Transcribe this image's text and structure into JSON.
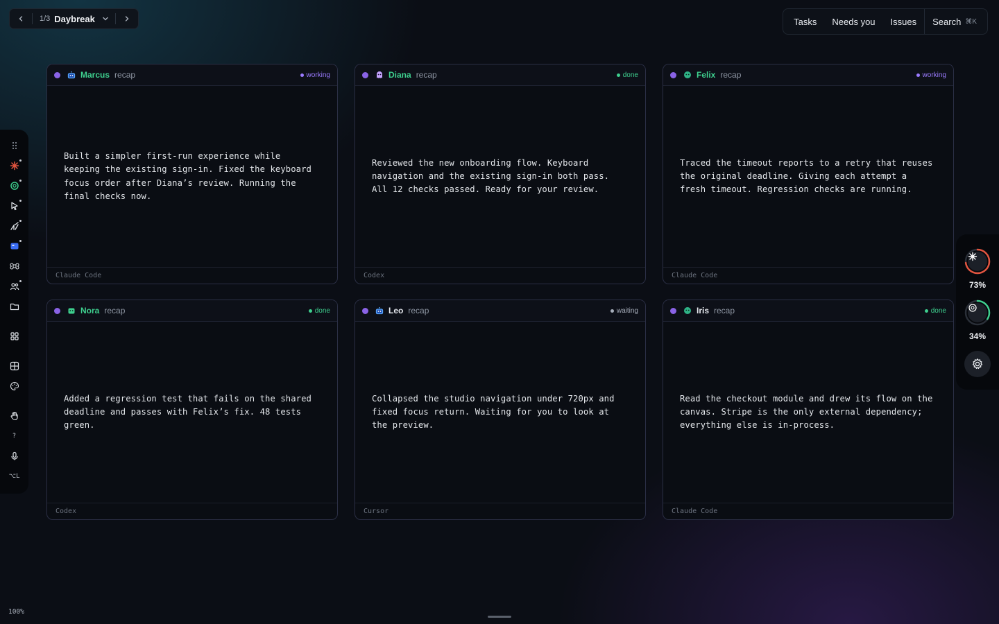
{
  "switcher": {
    "count": "1/3",
    "board_name": "Daybreak"
  },
  "topmenu": {
    "tasks": "Tasks",
    "needs_you": "Needs you",
    "issues": "Issues",
    "search": "Search",
    "search_kbd": "⌘K"
  },
  "left_toolbar": {
    "items": [
      "drag-handle-icon",
      "claude-icon",
      "openai-icon",
      "cursor-icon",
      "agent-icon",
      "app-icon",
      "command-icon",
      "people-icon",
      "folder-icon",
      "grid-icon",
      "table-icon",
      "palette-icon",
      "hand-icon",
      "help",
      "mic-icon",
      "shortcut"
    ],
    "help_label": "?",
    "shortcut_label": "⌥L"
  },
  "right_widget": {
    "claude_usage": "73%",
    "claude_fraction": 0.73,
    "claude_color": "#e2543f",
    "openai_usage": "34%",
    "openai_fraction": 0.34,
    "openai_color": "#3ecf8e"
  },
  "cards": [
    {
      "agent": "Marcus",
      "agent_color": "#3ecf8e",
      "kind": "recap",
      "status": "working",
      "status_color": "#9b7bff",
      "body": "Built a simpler first-run experience while keeping the existing sign-in. Fixed the keyboard focus order after Diana’s review. Running the final checks now.",
      "footer": "Claude Code"
    },
    {
      "agent": "Diana",
      "agent_color": "#3ecf8e",
      "kind": "recap",
      "status": "done",
      "status_color": "#3ecf8e",
      "body": "Reviewed the new onboarding flow. Keyboard navigation and the existing sign-in both pass. All 12 checks passed. Ready for your review.",
      "footer": "Codex"
    },
    {
      "agent": "Felix",
      "agent_color": "#3ecf8e",
      "kind": "recap",
      "status": "working",
      "status_color": "#9b7bff",
      "body": "Traced the timeout reports to a retry that reuses the original deadline. Giving each attempt a fresh timeout. Regression checks are running.",
      "footer": "Claude Code"
    },
    {
      "agent": "Nora",
      "agent_color": "#3ecf8e",
      "kind": "recap",
      "status": "done",
      "status_color": "#3ecf8e",
      "body": "Added a regression test that fails on the shared deadline and passes with Felix’s fix. 48 tests green.",
      "footer": "Codex"
    },
    {
      "agent": "Leo",
      "agent_color": "#e6e9ef",
      "kind": "recap",
      "status": "waiting",
      "status_color": "#a6adba",
      "body": "Collapsed the studio navigation under 720px and fixed focus return. Waiting for you to look at the preview.",
      "footer": "Cursor"
    },
    {
      "agent": "Iris",
      "agent_color": "#e6e9ef",
      "kind": "recap",
      "status": "done",
      "status_color": "#3ecf8e",
      "body": "Read the checkout module and drew its flow on the canvas. Stripe is the only external dependency; everything else is in-process.",
      "footer": "Claude Code"
    }
  ],
  "zoom": "100%"
}
